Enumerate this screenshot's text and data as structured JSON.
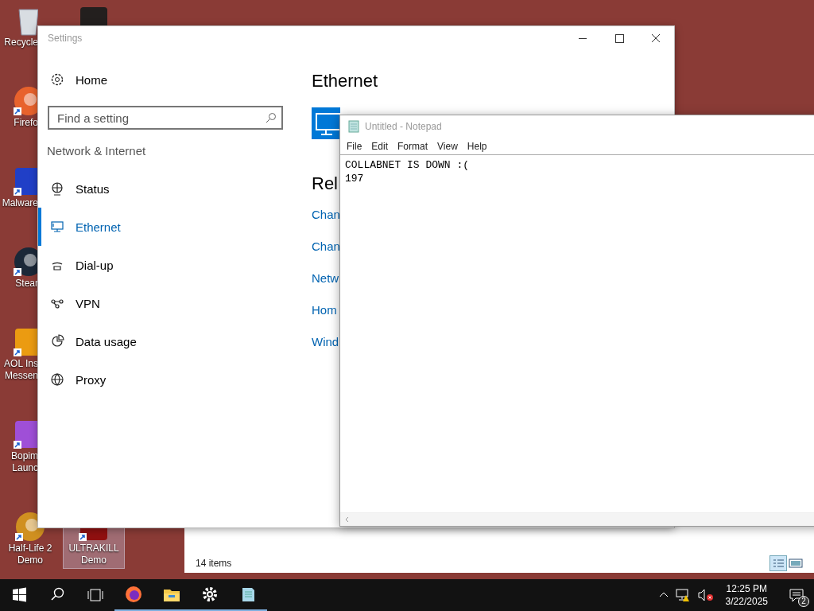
{
  "desktop_icons": [
    [
      {
        "kind": "recycle",
        "lines": [
          "Recycle"
        ],
        "selected": false
      },
      {
        "kind": "firefox",
        "lines": [
          "Firefo"
        ],
        "selected": false
      },
      {
        "kind": "malware",
        "lines": [
          "Malware"
        ],
        "selected": false
      },
      {
        "kind": "steam",
        "lines": [
          "Stear"
        ],
        "selected": false
      },
      {
        "kind": "aol",
        "lines": [
          "AOL Ins",
          "Messen"
        ],
        "selected": false
      },
      {
        "kind": "bopimo",
        "lines": [
          "Bopim",
          "Launc"
        ],
        "selected": false
      },
      {
        "kind": "halflife",
        "lines": [
          "Half-Life 2",
          "Demo"
        ],
        "selected": false
      }
    ],
    [
      {
        "kind": "dark"
      },
      {
        "kind": "ultrakill",
        "lines": [
          "ULTRAKILL",
          "Demo"
        ],
        "selected": true
      }
    ]
  ],
  "explorer": {
    "status": "14 items"
  },
  "settings": {
    "title": "Settings",
    "home": "Home",
    "search": {
      "placeholder": "Find a setting"
    },
    "section": "Network & Internet",
    "nav": [
      {
        "kind": "status",
        "label": "Status",
        "selected": false
      },
      {
        "kind": "ethernet",
        "label": "Ethernet",
        "selected": true
      },
      {
        "kind": "dialup",
        "label": "Dial-up",
        "selected": false
      },
      {
        "kind": "vpn",
        "label": "VPN",
        "selected": false
      },
      {
        "kind": "data",
        "label": "Data usage",
        "selected": false
      },
      {
        "kind": "proxy",
        "label": "Proxy",
        "selected": false
      }
    ],
    "page_title": "Ethernet",
    "related_heading": "Rel",
    "links": [
      "Chan",
      "Chan",
      "Netw",
      "Hom",
      "Wind"
    ]
  },
  "notepad": {
    "title": "Untitled - Notepad",
    "menu": [
      "File",
      "Edit",
      "Format",
      "View",
      "Help"
    ],
    "lines": [
      "COLLABNET IS DOWN :(",
      "197"
    ]
  },
  "taskbar": {
    "apps": [
      {
        "kind": "firefox",
        "running": true
      },
      {
        "kind": "explorer",
        "running": true
      },
      {
        "kind": "settings",
        "running": true
      },
      {
        "kind": "notepad",
        "running": true
      }
    ],
    "time": "12:25 PM",
    "date": "3/22/2025",
    "notifications": "2"
  }
}
